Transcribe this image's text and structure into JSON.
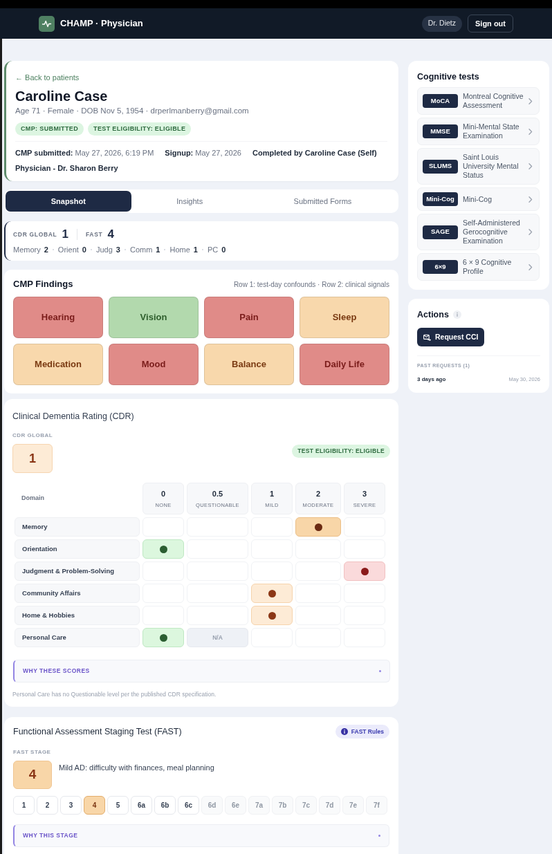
{
  "header": {
    "app_title": "CHAMP · Physician",
    "user": "Dr. Dietz",
    "sign_out": "Sign out"
  },
  "patient": {
    "back_link": "← Back to patients",
    "name": "Caroline Case",
    "details": "Age 71 · Female · DOB Nov 5, 1954 · drperlmanberry@gmail.com",
    "badges": [
      "CMP: SUBMITTED",
      "TEST ELIGIBILITY: ELIGIBLE"
    ],
    "meta": [
      {
        "kind": "field",
        "text": "**CMP submitted:** May 27, 2026, 6:19 PM"
      },
      {
        "kind": "field",
        "text": "**Signup:** May 27, 2026"
      },
      {
        "kind": "note",
        "text": "Completed by Caroline Case (Self)"
      }
    ],
    "physician": "Physician - Dr. Sharon Berry"
  },
  "tabs": [
    {
      "label": "Snapshot",
      "selected": true
    },
    {
      "label": "Insights",
      "selected": false
    },
    {
      "label": "Submitted Forms",
      "selected": false
    }
  ],
  "summary": {
    "scores": [
      {
        "label": "CDR GLOBAL",
        "value": "1"
      },
      {
        "label": "FAST",
        "value": "4"
      }
    ],
    "domains": [
      {
        "label": "Memory",
        "value": "2"
      },
      {
        "label": "Orient",
        "value": "0"
      },
      {
        "label": "Judg",
        "value": "3"
      },
      {
        "label": "Comm",
        "value": "1"
      },
      {
        "label": "Home",
        "value": "1"
      },
      {
        "label": "PC",
        "value": "0"
      }
    ]
  },
  "cmp_findings": {
    "title": "CMP Findings",
    "note": "Row 1: test-day confounds · Row 2: clinical signals",
    "items": [
      {
        "label": "Hearing",
        "color": "#e08b88"
      },
      {
        "label": "Vision",
        "color": "#b2d9ad"
      },
      {
        "label": "Pain",
        "color": "#e08b88"
      },
      {
        "label": "Sleep",
        "color": "#f8d8ac"
      },
      {
        "label": "Medication",
        "color": "#f8d8ac"
      },
      {
        "label": "Mood",
        "color": "#e08b88"
      },
      {
        "label": "Balance",
        "color": "#f8d8ac"
      },
      {
        "label": "Daily Life",
        "color": "#e08b88"
      }
    ]
  },
  "cognitive_tests": {
    "title": "Cognitive tests",
    "items": [
      {
        "code": "MoCA",
        "name": "Montreal Cognitive Assessment"
      },
      {
        "code": "MMSE",
        "name": "Mini-Mental State Examination"
      },
      {
        "code": "SLUMS",
        "name": "Saint Louis University Mental Status"
      },
      {
        "code": "Mini-Cog",
        "name": "Mini-Cog"
      },
      {
        "code": "SAGE",
        "name": "Self-Administered Gerocognitive Examination"
      },
      {
        "code": "6×9",
        "name": "6 × 9 Cognitive Profile"
      }
    ]
  },
  "actions": {
    "title": "Actions",
    "button": "Request CCI",
    "past_requests_label": "PAST REQUESTS (1)",
    "past_requests": [
      {
        "when": "3 days ago",
        "date": "May 30, 2026"
      }
    ]
  },
  "cdr": {
    "title": "Clinical Dementia Rating (CDR)",
    "global_label": "CDR GLOBAL",
    "global_value": "1",
    "eligibility_badge": "TEST ELIGIBILITY: ELIGIBLE",
    "domain_header": "Domain",
    "columns": [
      {
        "value": "0",
        "label": "NONE"
      },
      {
        "value": "0.5",
        "label": "QUESTIONABLE"
      },
      {
        "value": "1",
        "label": "MILD"
      },
      {
        "value": "2",
        "label": "MODERATE"
      },
      {
        "value": "3",
        "label": "SEVERE"
      }
    ],
    "rows": [
      {
        "domain": "Memory",
        "cells": [
          {
            "selected": false
          },
          {
            "selected": false
          },
          {
            "selected": false
          },
          {
            "selected": true
          },
          {
            "selected": false
          }
        ]
      },
      {
        "domain": "Orientation",
        "cells": [
          {
            "selected": true
          },
          {
            "selected": false
          },
          {
            "selected": false
          },
          {
            "selected": false
          },
          {
            "selected": false
          }
        ]
      },
      {
        "domain": "Judgment & Problem-Solving",
        "cells": [
          {
            "selected": false
          },
          {
            "selected": false
          },
          {
            "selected": false
          },
          {
            "selected": false
          },
          {
            "selected": true
          }
        ]
      },
      {
        "domain": "Community Affairs",
        "cells": [
          {
            "selected": false
          },
          {
            "selected": false
          },
          {
            "selected": true
          },
          {
            "selected": false
          },
          {
            "selected": false
          }
        ]
      },
      {
        "domain": "Home & Hobbies",
        "cells": [
          {
            "selected": false
          },
          {
            "selected": false
          },
          {
            "selected": true
          },
          {
            "selected": false
          },
          {
            "selected": false
          }
        ]
      },
      {
        "domain": "Personal Care",
        "cells": [
          {
            "selected": true
          },
          {
            "selected": false,
            "text": "N/A"
          },
          {
            "selected": false
          },
          {
            "selected": false
          },
          {
            "selected": false
          }
        ]
      }
    ],
    "why_label": "WHY THESE SCORES",
    "footnote": "Personal Care has no Questionable level per the published CDR specification."
  },
  "fast": {
    "title": "Functional Assessment Staging Test (FAST)",
    "rules_button": "FAST Rules",
    "stage_label": "FAST STAGE",
    "stage_value": "4",
    "stage_description": "Mild AD: difficulty with finances, meal planning",
    "stages": [
      {
        "label": "1",
        "selected": false,
        "disabled": false
      },
      {
        "label": "2",
        "selected": false,
        "disabled": false
      },
      {
        "label": "3",
        "selected": false,
        "disabled": false
      },
      {
        "label": "4",
        "selected": true,
        "disabled": false
      },
      {
        "label": "5",
        "selected": false,
        "disabled": false
      },
      {
        "label": "6a",
        "selected": false,
        "disabled": false
      },
      {
        "label": "6b",
        "selected": false,
        "disabled": false
      },
      {
        "label": "6c",
        "selected": false,
        "disabled": false
      },
      {
        "label": "6d",
        "selected": false,
        "disabled": true
      },
      {
        "label": "6e",
        "selected": false,
        "disabled": true
      },
      {
        "label": "7a",
        "selected": false,
        "disabled": true
      },
      {
        "label": "7b",
        "selected": false,
        "disabled": true
      },
      {
        "label": "7c",
        "selected": false,
        "disabled": true
      },
      {
        "label": "7d",
        "selected": false,
        "disabled": true
      },
      {
        "label": "7e",
        "selected": false,
        "disabled": true
      },
      {
        "label": "7f",
        "selected": false,
        "disabled": true
      }
    ],
    "why_label": "WHY THIS STAGE"
  }
}
